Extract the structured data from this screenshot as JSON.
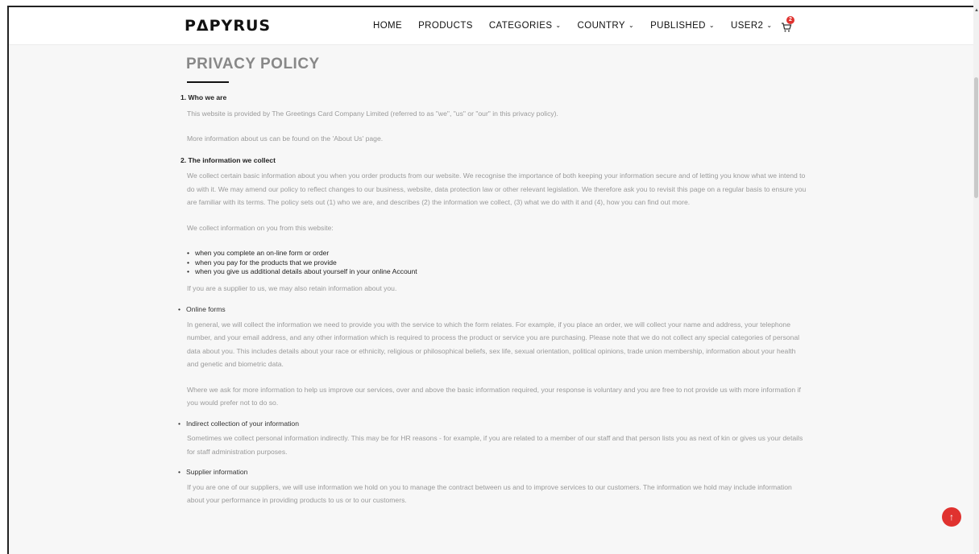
{
  "brand": {
    "logo_text": "PΔPYRUS"
  },
  "nav": {
    "items": [
      {
        "label": "HOME",
        "caret": ""
      },
      {
        "label": "PRODUCTS",
        "caret": ""
      },
      {
        "label": "CATEGORIES",
        "caret": "⌄"
      },
      {
        "label": "COUNTRY",
        "caret": "⌄"
      },
      {
        "label": "PUBLISHED",
        "caret": "⌄"
      },
      {
        "label": "USER2",
        "caret": "⌄"
      }
    ],
    "cart_icon": "cart-icon",
    "cart_count": "2"
  },
  "page": {
    "title": "PRIVACY POLICY",
    "s1_heading": "1. Who we are",
    "s1_p1": "This website is provided by The Greetings Card Company Limited (referred to as \"we\", \"us\" or \"our\" in this privacy policy).",
    "s1_p2": "More information about us can be found on the 'About Us' page.",
    "s2_heading": "2. The information we collect",
    "s2_p1": "We collect certain basic information about you when you order products from our website. We recognise the importance of both keeping your information secure and of letting you know what we intend to do with it. We may amend our policy to reflect changes to our business, website, data protection law or other relevant legislation. We therefore ask you to revisit this page on a regular basis to ensure you are familiar with its terms. The policy sets out (1) who we are, and describes (2) the information we collect, (3) what we do with it and (4), how you can find out more.",
    "s2_p2": "We collect information on you from this website:",
    "s2_bullets": [
      "when you complete an on-line form or order",
      "when you pay for the products that we provide",
      "when you give us additional details about yourself in your online Account"
    ],
    "s2_p3": "If you are a supplier to us, we may also retain information about you.",
    "online_forms_heading": "Online forms",
    "online_forms_p1": "In general, we will collect the information we need to provide you with the service to which the form relates. For example, if you place an order, we will collect your name and address, your telephone number, and your email address, and any other information which is required to process the product or service you are purchasing. Please note that we do not collect any special categories of personal data about you. This includes details about your race or ethnicity, religious or philosophical beliefs, sex life, sexual orientation, political opinions, trade union membership, information about your health and genetic and biometric data.",
    "online_forms_p2": "Where we ask for more information to help us improve our services, over and above the basic information required, your response is voluntary and you are free to not provide us with more information if you would prefer not to do so.",
    "indirect_heading": "Indirect collection of your information",
    "indirect_p1": "Sometimes we collect personal information indirectly. This may be for HR reasons - for example, if you are related to a member of our staff and that person lists you as next of kin or gives us your details for staff administration purposes.",
    "supplier_heading": "Supplier information",
    "supplier_p1": "If you are one of our suppliers, we will use information we hold on you to manage the contract between us and to improve services to our customers. The information we hold may include information about your performance in providing products to us or to our customers."
  },
  "scroll_top": {
    "icon": "arrow-up-icon",
    "glyph": "↑"
  },
  "colors": {
    "accent": "#e0322f",
    "heading": "#888888",
    "body_text": "#9a9a9a"
  }
}
